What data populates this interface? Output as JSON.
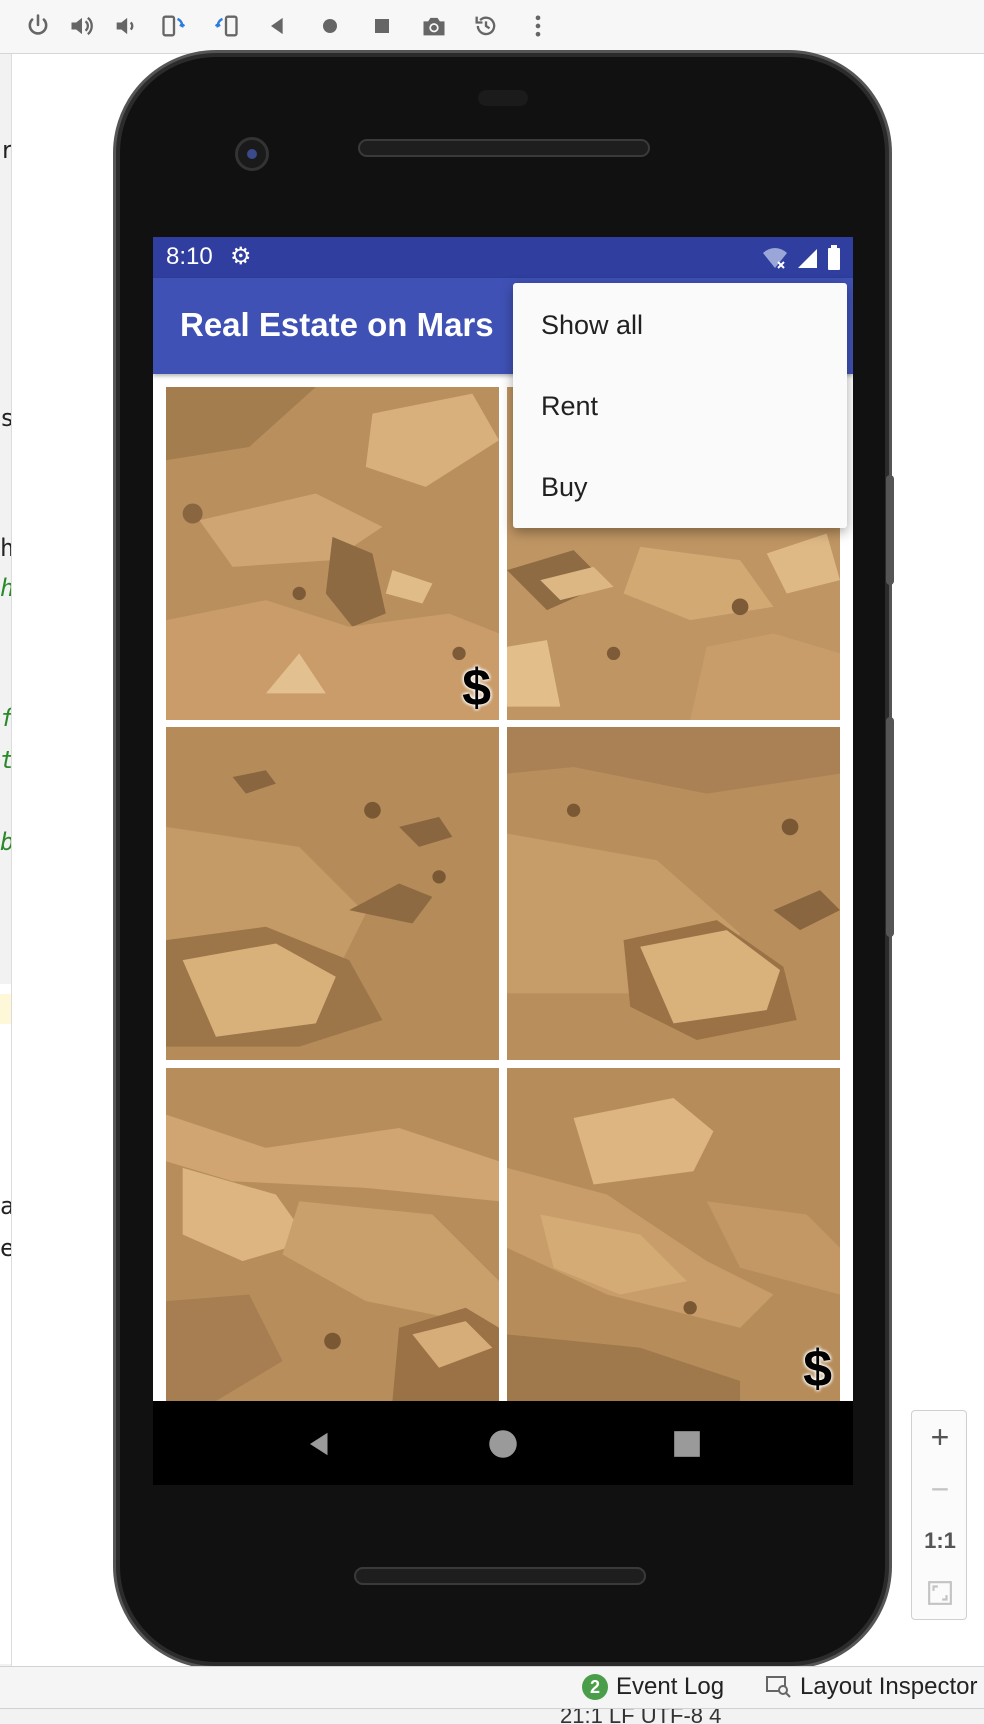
{
  "ide": {
    "toolbar": {
      "buttons": [
        "power-icon",
        "volume-up-icon",
        "volume-down-icon",
        "rotate-left-icon",
        "rotate-right-icon",
        "back-icon",
        "home-icon",
        "overview-icon",
        "camera-icon",
        "replay-icon",
        "more-icon"
      ]
    },
    "editor_fragments": [
      "r",
      "s",
      "h",
      "h",
      "f",
      "t",
      "b",
      "a",
      "e"
    ],
    "bottom_bar": {
      "event_log_count": "2",
      "event_log_label": "Event Log",
      "layout_inspector_label": "Layout Inspector"
    },
    "status_text": "21:1  LF  UTF-8  4",
    "zoom": {
      "zoom_in": "+",
      "zoom_out": "−",
      "actual_size": "1:1"
    }
  },
  "device": {
    "status_bar": {
      "time": "8:10"
    },
    "app_bar": {
      "title": "Real Estate on Mars"
    },
    "overflow_menu": {
      "items": [
        "Show all",
        "Rent",
        "Buy"
      ]
    },
    "grid": {
      "tiles": [
        {
          "badge": "$"
        },
        {
          "badge": ""
        },
        {
          "badge": ""
        },
        {
          "badge": ""
        },
        {
          "badge": ""
        },
        {
          "badge": "$"
        }
      ]
    }
  },
  "colors": {
    "status_bar": "#303f9f",
    "app_bar": "#3f51b5",
    "mars_sand": "#c49a66"
  }
}
